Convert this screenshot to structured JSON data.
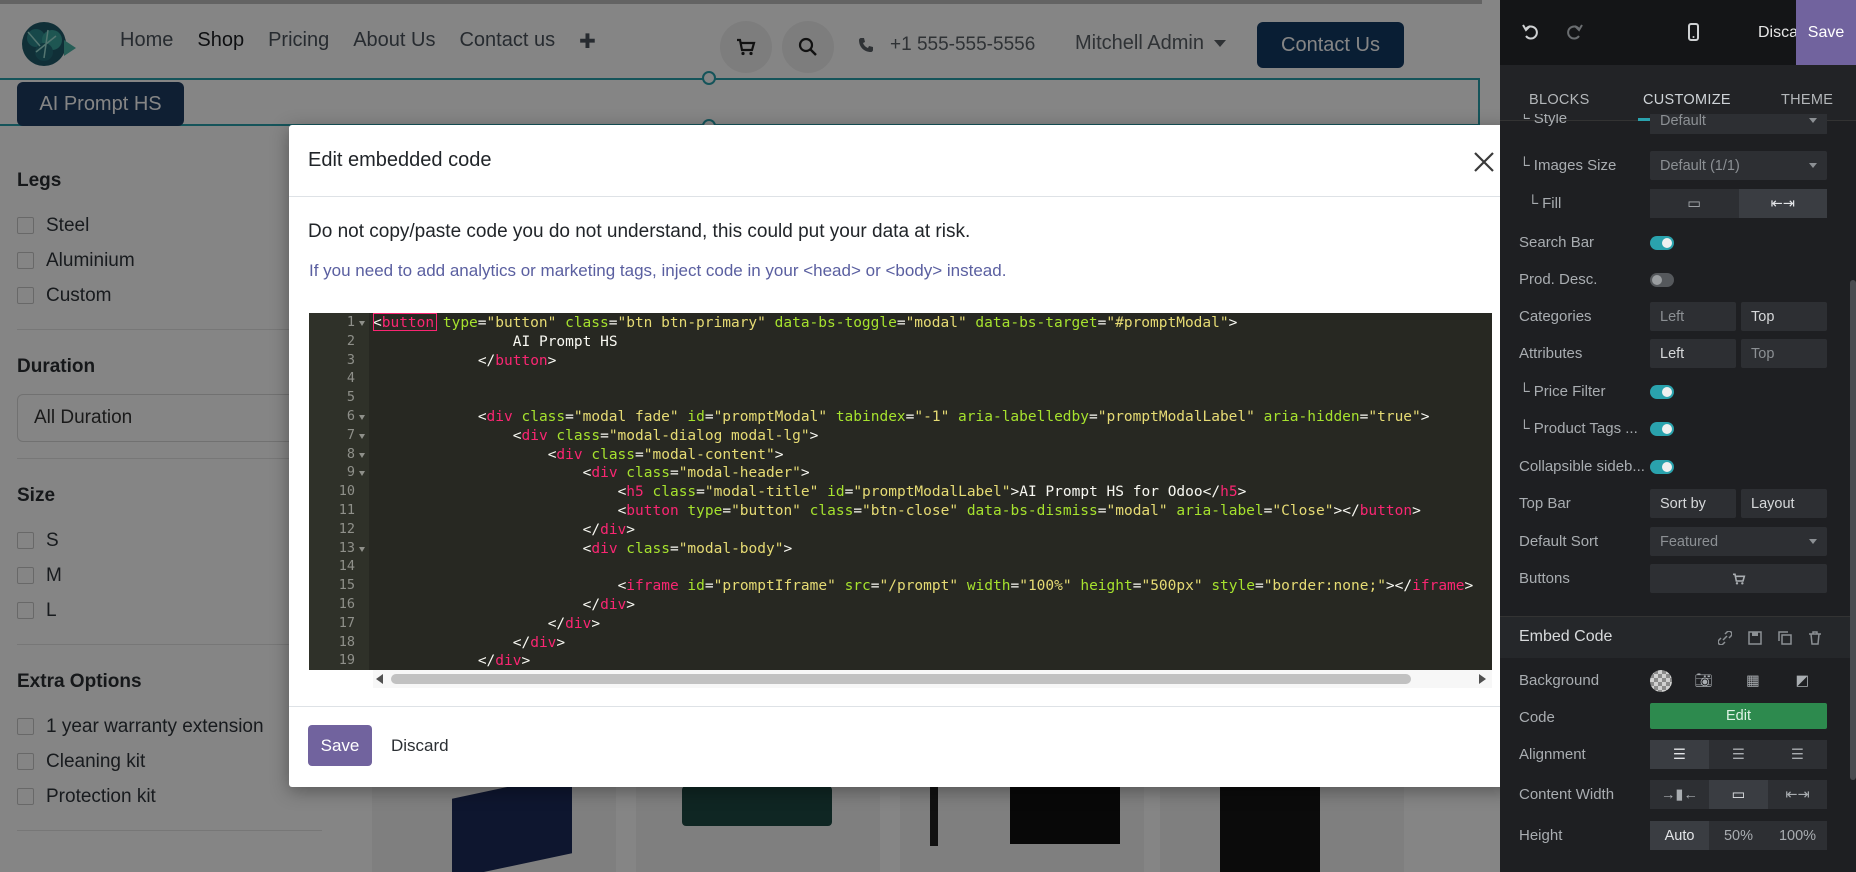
{
  "site": {
    "nav": [
      "Home",
      "Shop",
      "Pricing",
      "About Us",
      "Contact us"
    ],
    "nav_active": "Shop",
    "phone": "+1 555-555-5556",
    "user": "Mitchell Admin",
    "contact_button": "Contact Us",
    "ai_prompt_button": "AI Prompt HS"
  },
  "filters": {
    "legs": {
      "title": "Legs",
      "options": [
        "Steel",
        "Aluminium",
        "Custom"
      ]
    },
    "duration": {
      "title": "Duration",
      "selected": "All Duration"
    },
    "size": {
      "title": "Size",
      "options": [
        "S",
        "M",
        "L"
      ]
    },
    "extra": {
      "title": "Extra Options",
      "options": [
        "1 year warranty extension",
        "Cleaning kit",
        "Protection kit"
      ]
    }
  },
  "modal": {
    "title": "Edit embedded code",
    "warning": "Do not copy/paste code you do not understand, this could put your data at risk.",
    "hint": "If you need to add analytics or marketing tags, inject code in your <head> or <body> instead.",
    "save": "Save",
    "discard": "Discard",
    "code_lines": [
      "<button type=\"button\" class=\"btn btn-primary\" data-bs-toggle=\"modal\" data-bs-target=\"#promptModal\">",
      "                AI Prompt HS",
      "            </button>",
      "",
      "",
      "            <div class=\"modal fade\" id=\"promptModal\" tabindex=\"-1\" aria-labelledby=\"promptModalLabel\" aria-hidden=\"true\">",
      "                <div class=\"modal-dialog modal-lg\">",
      "                    <div class=\"modal-content\">",
      "                        <div class=\"modal-header\">",
      "                            <h5 class=\"modal-title\" id=\"promptModalLabel\">AI Prompt HS for Odoo</h5>",
      "                            <button type=\"button\" class=\"btn-close\" data-bs-dismiss=\"modal\" aria-label=\"Close\"></button>",
      "                        </div>",
      "                        <div class=\"modal-body\">",
      "",
      "                            <iframe id=\"promptIframe\" src=\"/prompt\" width=\"100%\" height=\"500px\" style=\"border:none;\"></iframe>",
      "                        </div>",
      "                    </div>",
      "                </div>",
      "            </div>"
    ],
    "folded_lines": [
      1,
      6,
      7,
      8,
      9,
      13
    ]
  },
  "sidebar": {
    "discard": "Discard",
    "save": "Save",
    "tabs": [
      "BLOCKS",
      "CUSTOMIZE",
      "THEME"
    ],
    "active_tab": "CUSTOMIZE",
    "rows": {
      "style": {
        "label": "Style",
        "value": "Default"
      },
      "images_size": {
        "label": "Images Size",
        "value": "Default (1/1)"
      },
      "fill": {
        "label": "Fill"
      },
      "search_bar": {
        "label": "Search Bar",
        "on": true
      },
      "prod_desc": {
        "label": "Prod. Desc.",
        "on": false
      },
      "categories": {
        "label": "Categories",
        "options": [
          "Left",
          "Top"
        ]
      },
      "attributes": {
        "label": "Attributes",
        "options": [
          "Left",
          "Top"
        ]
      },
      "price_filter": {
        "label": "Price Filter",
        "on": true
      },
      "product_tags": {
        "label": "Product Tags ...",
        "on": true
      },
      "collapsible": {
        "label": "Collapsible sideb...",
        "on": true
      },
      "top_bar": {
        "label": "Top Bar",
        "options": [
          "Sort by",
          "Layout"
        ]
      },
      "default_sort": {
        "label": "Default Sort",
        "value": "Featured"
      },
      "buttons": {
        "label": "Buttons"
      }
    },
    "embed_code": {
      "title": "Embed Code",
      "background": "Background",
      "code": "Code",
      "edit": "Edit",
      "alignment": "Alignment",
      "content_width": "Content Width",
      "height": "Height",
      "height_options": [
        "Auto",
        "50%",
        "100%"
      ]
    }
  }
}
